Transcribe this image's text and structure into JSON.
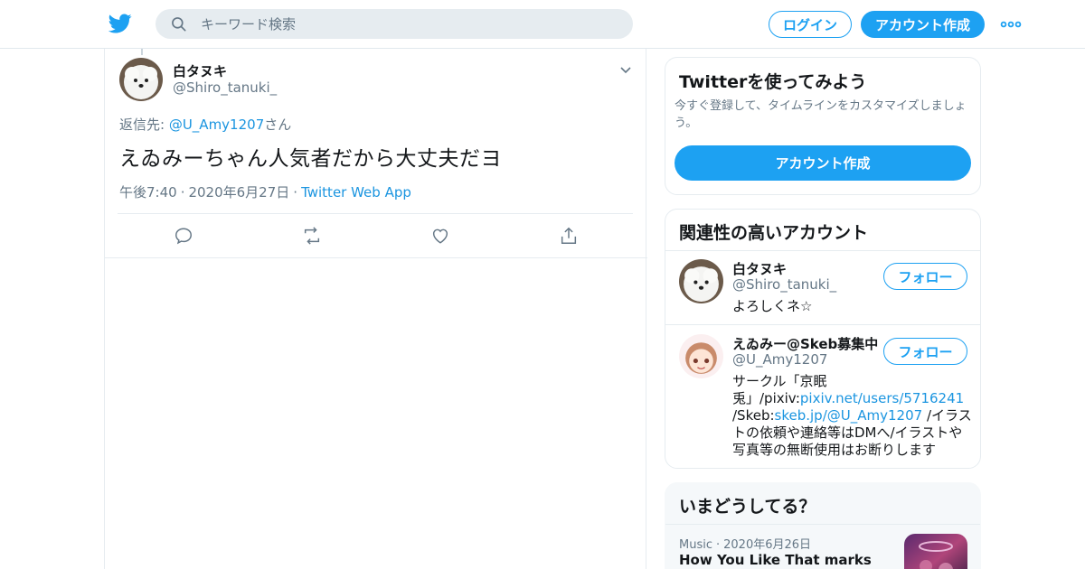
{
  "header": {
    "logo_icon": "twitter-bird-icon",
    "search_placeholder": "キーワード検索",
    "login_label": "ログイン",
    "signup_label": "アカウント作成",
    "more_icon": "more-dots-icon",
    "brand_color": "#1da1f2"
  },
  "tweet": {
    "display_name": "白タヌキ",
    "handle": "@Shiro_tanuki_",
    "reply_prefix": "返信先: ",
    "reply_mention": "@U_Amy1207",
    "reply_suffix": "さん",
    "text": "えゐみーちゃん人気者だから大丈夫だヨ",
    "time": "午後7:40",
    "date": "2020年6月27日",
    "source": "Twitter Web App",
    "separator": "·",
    "actions": [
      "reply-icon",
      "retweet-icon",
      "like-icon",
      "share-icon"
    ]
  },
  "signup_card": {
    "title": "Twitterを使ってみよう",
    "subtitle": "今すぐ登録して、タイムラインをカスタマイズしましょう。",
    "button_label": "アカウント作成"
  },
  "related_card": {
    "title": "関連性の高いアカウント",
    "follow_label": "フォロー",
    "accounts": [
      {
        "name": "白タヌキ",
        "handle": "@Shiro_tanuki_",
        "bio": "よろしくネ☆"
      },
      {
        "name": "えゐみー@Skeb募集中",
        "handle": "@U_Amy1207",
        "bio_part1": "サークル「京眠兎」/pixiv:",
        "bio_link1": "pixiv.net/users/5716241",
        "bio_part2": " /Skeb:",
        "bio_link2": "skeb.jp/@U_Amy1207",
        "bio_part3": " /イラストの依頼や連絡等はDMへ/イラストや写真等の無断使用はお断りします"
      }
    ]
  },
  "trends_card": {
    "title": "いまどうしてる？",
    "category": "Music",
    "date": "2020年6月26日",
    "separator": "·",
    "headline": "How You Like That marks"
  }
}
